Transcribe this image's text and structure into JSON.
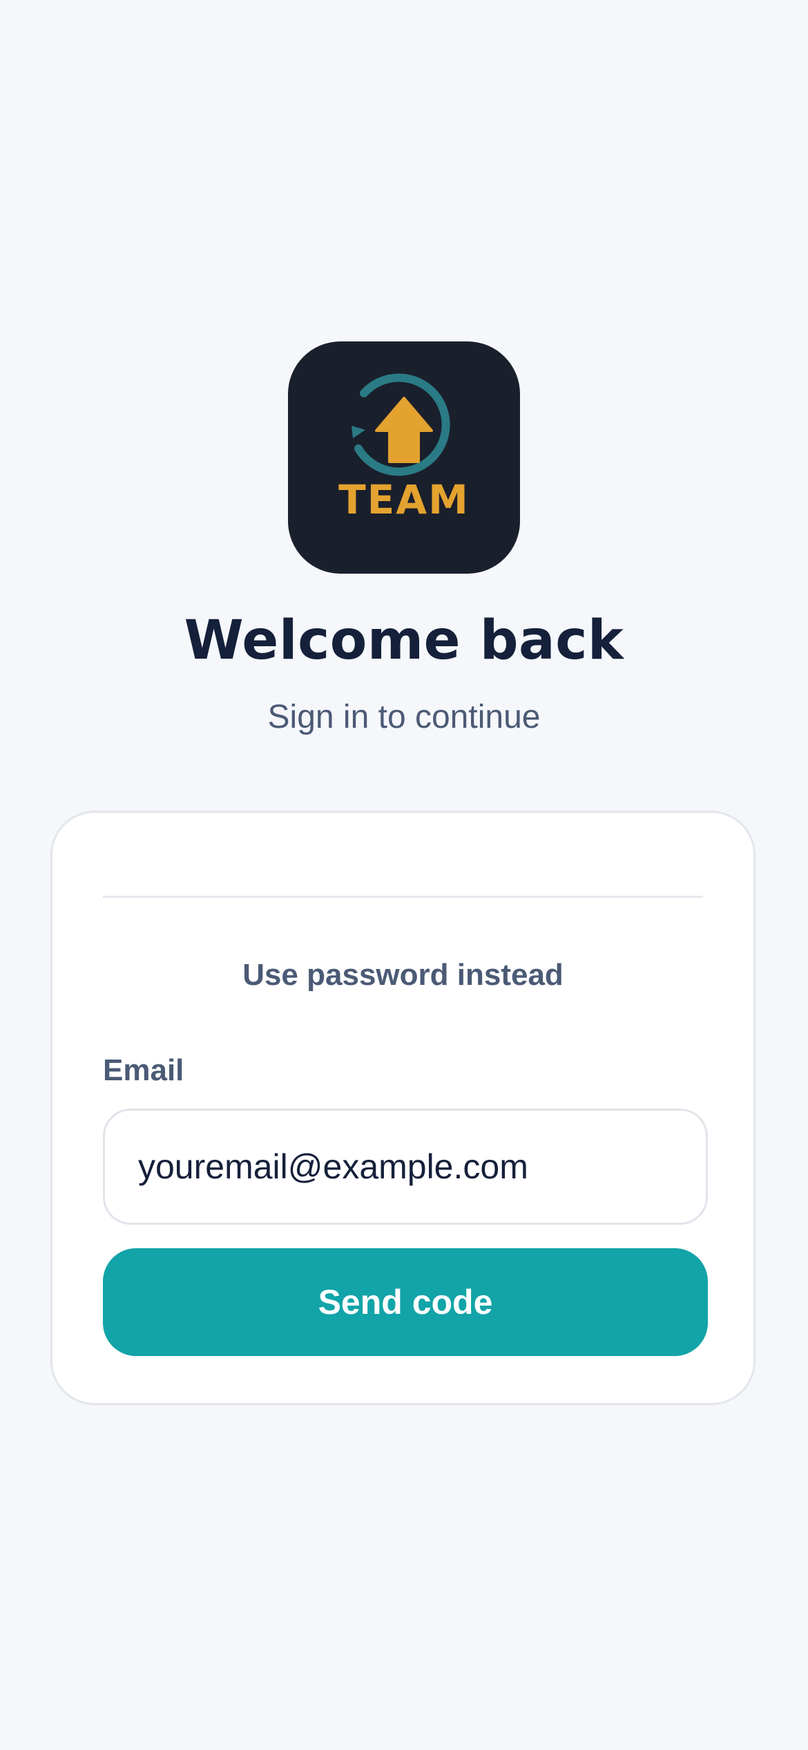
{
  "app_icon": {
    "text": "TEAM",
    "icon": "circular-arrow-up-icon",
    "background": "#1a1f2c",
    "ring_color": "#2a7b85",
    "accent_color": "#e4a22f"
  },
  "header": {
    "title": "Welcome back",
    "subtitle": "Sign in to continue"
  },
  "form": {
    "alt_link": "Use password instead",
    "email_label": "Email",
    "email_placeholder": "youremail@example.com",
    "email_value": "",
    "submit_label": "Send code",
    "accent_color": "#12a4a8"
  }
}
